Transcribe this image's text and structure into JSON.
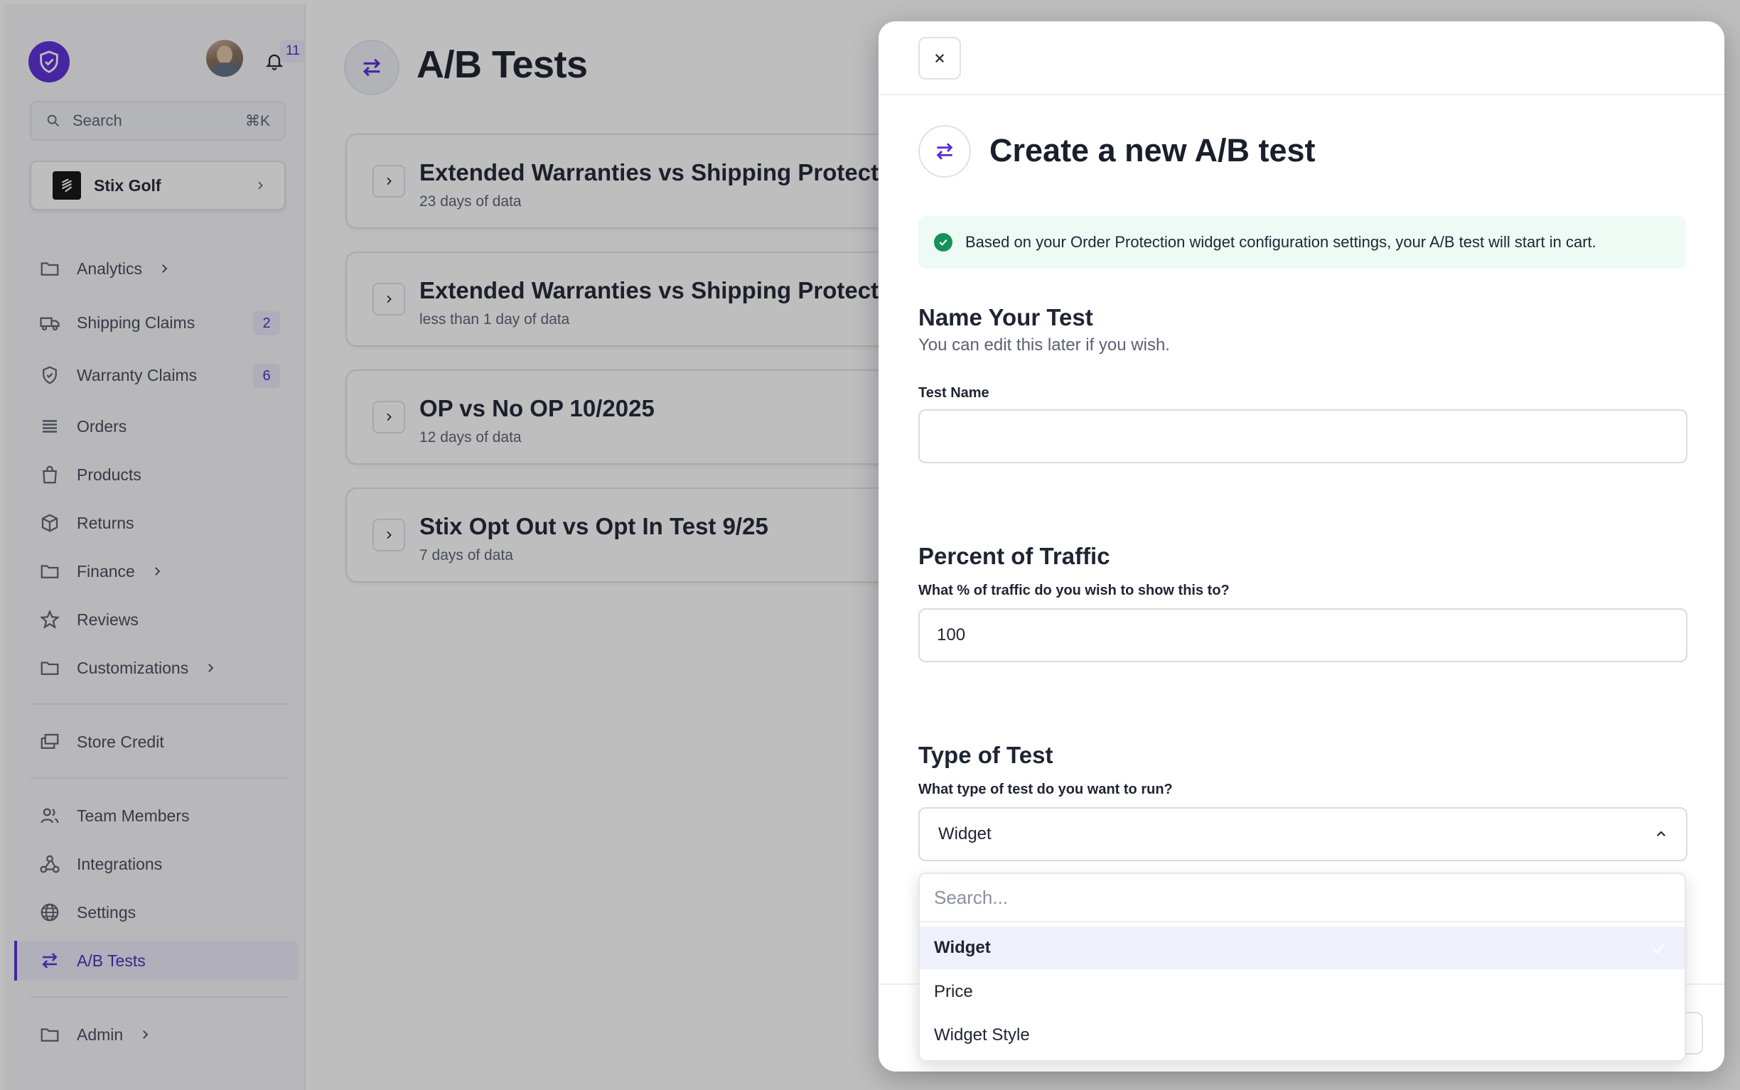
{
  "header": {
    "notifications_count": "11"
  },
  "search": {
    "placeholder": "Search",
    "shortcut": "⌘K"
  },
  "store": {
    "name": "Stix Golf"
  },
  "sidebar": {
    "items": [
      {
        "label": "Analytics",
        "icon": "folder-icon",
        "expandable": true
      },
      {
        "label": "Shipping Claims",
        "icon": "truck-icon",
        "count": "2"
      },
      {
        "label": "Warranty Claims",
        "icon": "shield-icon",
        "count": "6"
      },
      {
        "label": "Orders",
        "icon": "list-icon"
      },
      {
        "label": "Products",
        "icon": "bag-icon"
      },
      {
        "label": "Returns",
        "icon": "box-icon"
      },
      {
        "label": "Finance",
        "icon": "folder-icon",
        "expandable": true
      },
      {
        "label": "Reviews",
        "icon": "star-icon"
      },
      {
        "label": "Customizations",
        "icon": "folder-icon",
        "expandable": true
      },
      {
        "label": "Store Credit",
        "icon": "credit-icon"
      },
      {
        "label": "Team Members",
        "icon": "users-icon"
      },
      {
        "label": "Integrations",
        "icon": "webhook-icon"
      },
      {
        "label": "Settings",
        "icon": "globe-icon"
      },
      {
        "label": "A/B Tests",
        "icon": "swap-icon",
        "active": true
      },
      {
        "label": "Admin",
        "icon": "folder-icon",
        "expandable": true
      }
    ]
  },
  "main": {
    "title": "A/B Tests",
    "tests": [
      {
        "name": "Extended Warranties vs Shipping Protection",
        "sub": "23 days of data"
      },
      {
        "name": "Extended Warranties vs Shipping Protection",
        "sub": "less than 1 day of data"
      },
      {
        "name": "OP vs No OP 10/2025",
        "sub": "12 days of data"
      },
      {
        "name": "Stix Opt Out vs Opt In Test 9/25",
        "sub": "7 days of data"
      }
    ]
  },
  "modal": {
    "title": "Create a new A/B test",
    "notice": "Based on your Order Protection widget configuration settings, your A/B test will start in cart.",
    "name_section": {
      "title": "Name Your Test",
      "subtitle": "You can edit this later if you wish.",
      "label": "Test Name",
      "value": ""
    },
    "traffic_section": {
      "title": "Percent of Traffic",
      "label": "What % of traffic do you wish to show this to?",
      "value": "100"
    },
    "type_section": {
      "title": "Type of Test",
      "label": "What type of test do you want to run?",
      "selected": "Widget",
      "search_placeholder": "Search...",
      "options": [
        "Widget",
        "Price",
        "Widget Style"
      ]
    }
  },
  "colors": {
    "accent": "#5b2bd9",
    "success": "#14935a",
    "notice_bg": "#eefbf4"
  }
}
